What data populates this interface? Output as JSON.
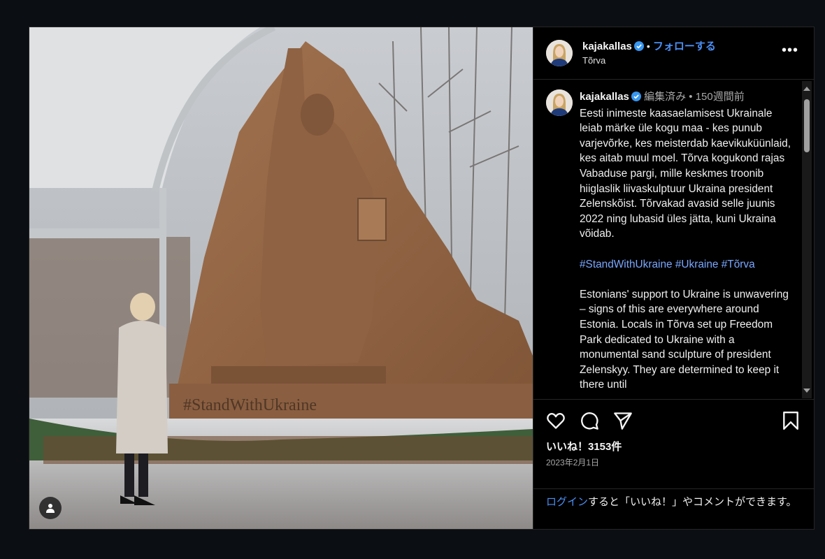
{
  "post": {
    "username": "kajakallas",
    "follow_label": "フォローする",
    "location": "Tõrva",
    "more_label": "•••",
    "caption_meta_edited": "編集済み",
    "caption_meta_time": "150週間前",
    "caption_et": "Eesti inimeste kaasaelamisest Ukrainale leiab märke üle kogu maa - kes punub varjevõrke, kes meisterdab kaevikuküünlaid, kes aitab muul moel. Tõrva kogukond rajas Vabaduse pargi, mille keskmes troonib hiiglaslik liivaskulptuur Ukraina president Zelenskõist. Tõrvakad avasid selle juunis 2022 ning lubasid üles jätta, kuni Ukraina võidab.",
    "hashtags": "#StandWithUkraine #Ukraine #Tõrva",
    "caption_en": "Estonians' support to Ukraine is unwavering – signs of this are everywhere around Estonia. Locals in Tõrva set up Freedom Park dedicated to Ukraine with a monumental sand sculpture of president Zelenskyy. They are determined to keep it there until",
    "likes": "いいね！3153件",
    "date": "2023年2月1日",
    "login_link": "ログイン",
    "login_rest": "すると「いいね！」やコメントができます。",
    "photo_inscription": "#StandWithUkraine"
  },
  "icons": {
    "like": "heart-icon",
    "comment": "comment-icon",
    "share": "paper-plane-icon",
    "save": "bookmark-icon",
    "tag": "user-tag-icon",
    "verified": "verified-badge-icon"
  },
  "colors": {
    "link": "#4b8ff5",
    "hashtag": "#7aa7ff",
    "verified": "#3897f0",
    "background": "#0b0e13"
  }
}
